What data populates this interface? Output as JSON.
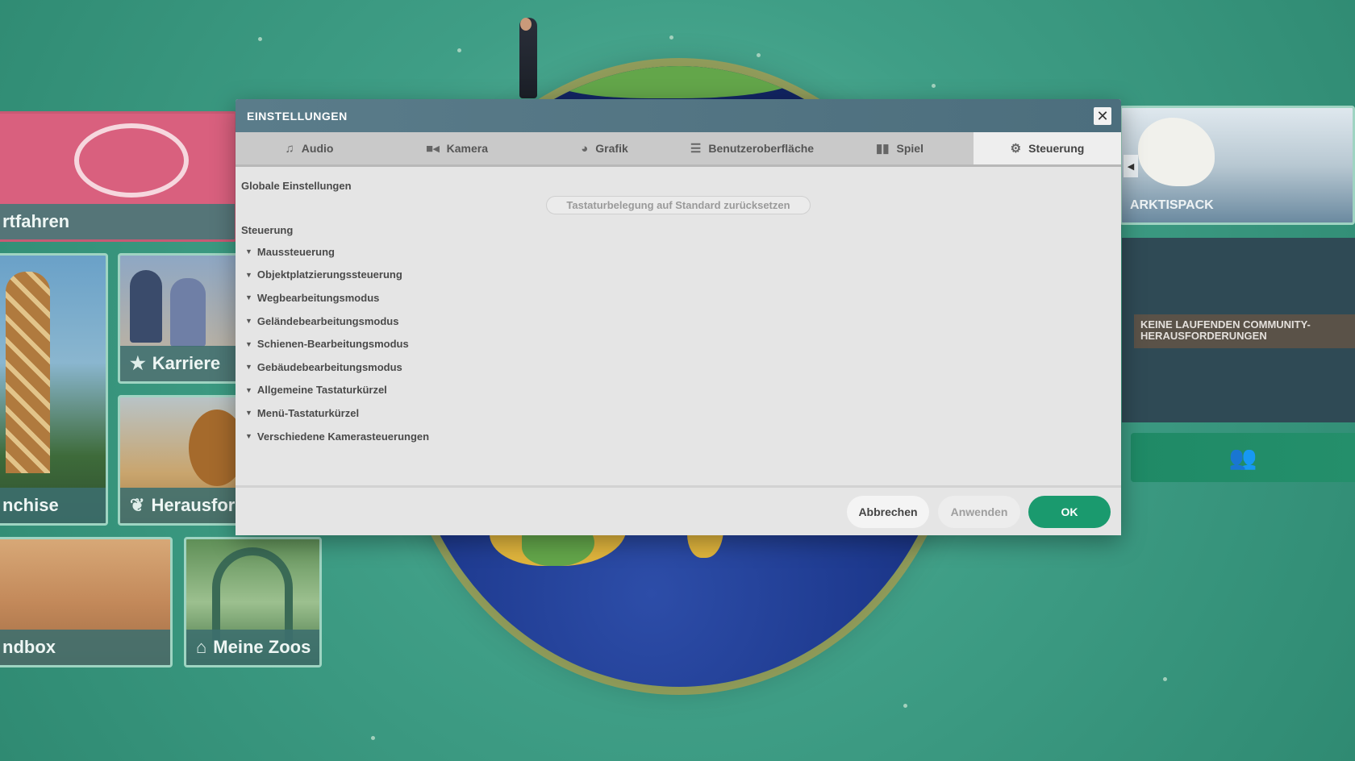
{
  "background": {
    "left_tiles": {
      "continue_label": "rtfahren",
      "career_label": "Karriere",
      "franchise_label": "nchise",
      "challenge_label": "Herausfor",
      "sandbox_label": "ndbox",
      "myzoos_label": "Meine Zoos"
    },
    "right_panel": {
      "dlc_label": "ARKTISPACK",
      "community_text": "KEINE LAUFENDEN COMMUNITY-HERAUSFORDERUNGEN"
    }
  },
  "dialog": {
    "title": "EINSTELLUNGEN",
    "tabs": [
      {
        "label": "Audio",
        "icon": "music-note-icon"
      },
      {
        "label": "Kamera",
        "icon": "camera-icon"
      },
      {
        "label": "Grafik",
        "icon": "palette-icon"
      },
      {
        "label": "Benutzeroberfläche",
        "icon": "list-icon"
      },
      {
        "label": "Spiel",
        "icon": "bar-chart-icon"
      },
      {
        "label": "Steuerung",
        "icon": "gear-icon"
      }
    ],
    "active_tab": "Steuerung",
    "global_settings_label": "Globale Einstellungen",
    "reset_button_label": "Tastaturbelegung auf Standard zurücksetzen",
    "controls_label": "Steuerung",
    "control_groups": [
      "Maussteuerung",
      "Objektplatzierungssteuerung",
      "Wegbearbeitungsmodus",
      "Geländebearbeitungsmodus",
      "Schienen-Bearbeitungsmodus",
      "Gebäudebearbeitungsmodus",
      "Allgemeine Tastaturkürzel",
      "Menü-Tastaturkürzel",
      "Verschiedene Kamerasteuerungen"
    ],
    "footer": {
      "cancel_label": "Abbrechen",
      "apply_label": "Anwenden",
      "ok_label": "OK"
    }
  },
  "colors": {
    "accent_ok": "#1a9a6e",
    "header": "#5a7c8a",
    "background": "#3f9e86",
    "franchise_tile": "#d9607e"
  }
}
